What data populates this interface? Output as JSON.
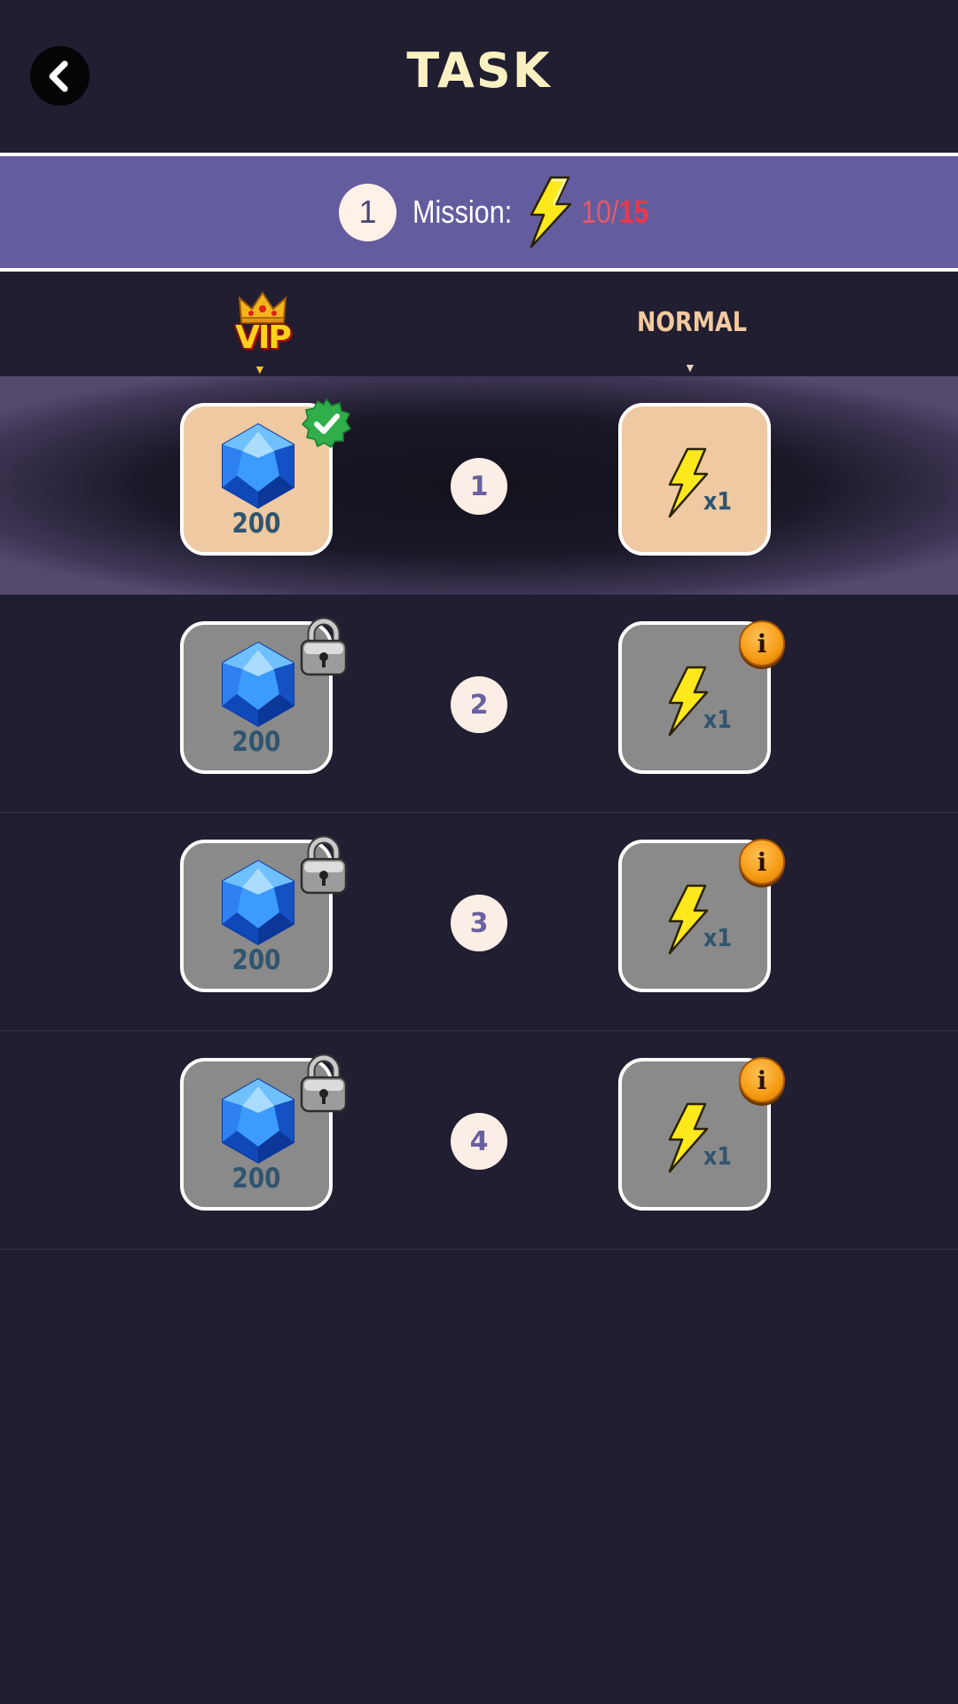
{
  "header": {
    "title": "TASK",
    "back_icon": "chevron-left-icon"
  },
  "mission": {
    "level": "1",
    "label": "Mission:",
    "icon": "lightning-bolt-icon",
    "progress_current": "10/",
    "progress_goal": "15"
  },
  "columns": {
    "vip": {
      "label": "VIP",
      "icon": "crown-icon"
    },
    "normal": {
      "label": "NORMAL"
    }
  },
  "tasks": [
    {
      "step": "1",
      "state": "claimable",
      "vip": {
        "icon": "blue-gem-icon",
        "amount": "200",
        "badge": "check-icon"
      },
      "normal": {
        "icon": "lightning-bolt-icon",
        "qty": "x1",
        "badge": "none"
      }
    },
    {
      "step": "2",
      "state": "locked",
      "vip": {
        "icon": "blue-gem-icon",
        "amount": "200",
        "badge": "lock-icon"
      },
      "normal": {
        "icon": "lightning-bolt-icon",
        "qty": "x1",
        "badge": "i"
      }
    },
    {
      "step": "3",
      "state": "locked",
      "vip": {
        "icon": "blue-gem-icon",
        "amount": "200",
        "badge": "lock-icon"
      },
      "normal": {
        "icon": "lightning-bolt-icon",
        "qty": "x1",
        "badge": "i"
      }
    },
    {
      "step": "4",
      "state": "locked",
      "vip": {
        "icon": "blue-gem-icon",
        "amount": "200",
        "badge": "lock-icon"
      },
      "normal": {
        "icon": "lightning-bolt-icon",
        "qty": "x1",
        "badge": "i"
      }
    }
  ],
  "colors": {
    "background": "#201e30",
    "mission_bar": "#635c9f",
    "claimable_card": "#eec9a1",
    "locked_card": "#8a8a8a",
    "progress_goal": "#e8394c"
  }
}
